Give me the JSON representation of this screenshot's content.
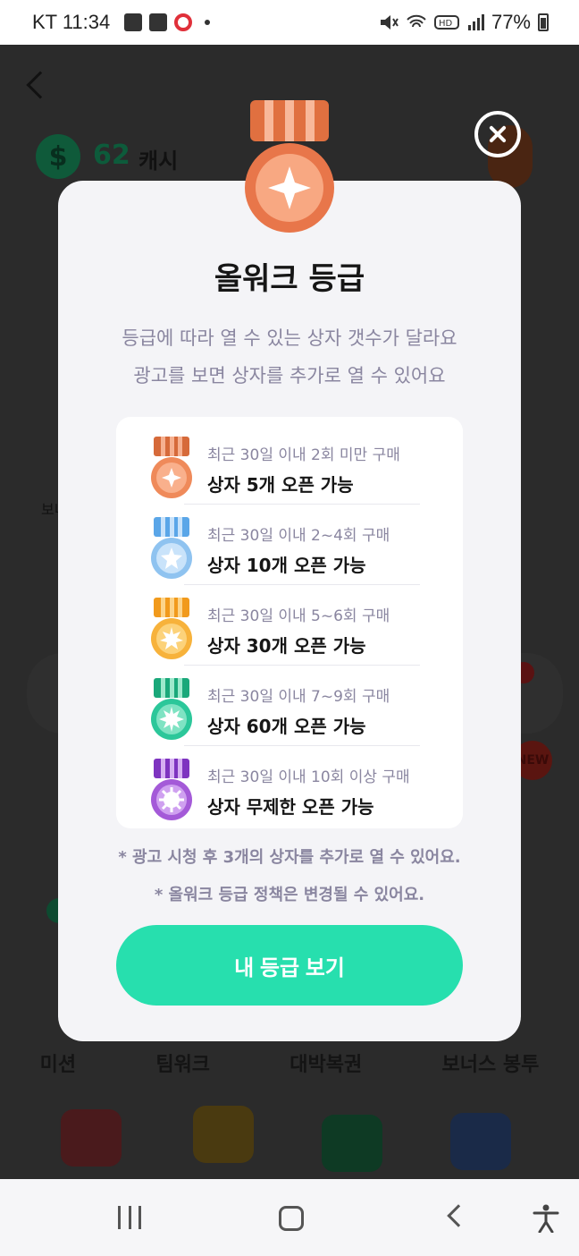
{
  "status_bar": {
    "carrier_time": "KT 11:34",
    "battery": "77%",
    "icons": [
      "gallery-icon",
      "pdf-icon",
      "app-badge-icon",
      "mute-icon",
      "wifi-icon",
      "hd-icon",
      "signal-icon",
      "battery-icon"
    ]
  },
  "background": {
    "cash_amount": "62",
    "cash_unit": "캐시",
    "section_label": "보너",
    "new_badge": "NEW",
    "menu": [
      "미션",
      "팀워크",
      "대박복권",
      "보너스 봉투"
    ]
  },
  "modal": {
    "title": "올워크 등급",
    "subtitle_1": "등급에 따라 열 수 있는 상자 갯수가 달라요",
    "subtitle_2": "광고를 보면 상자를 추가로 열 수 있어요",
    "tiers": [
      {
        "condition": "최근 30일 이내 2회 미만 구매",
        "open": "상자 5개 오픈 가능",
        "color": "#ef8a5a"
      },
      {
        "condition": "최근 30일 이내 2~4회 구매",
        "open": "상자 10개 오픈 가능",
        "color": "#8fc3f0"
      },
      {
        "condition": "최근 30일 이내 5~6회 구매",
        "open": "상자 30개 오픈 가능",
        "color": "#f7b23b"
      },
      {
        "condition": "최근 30일 이내 7~9회 구매",
        "open": "상자 60개 오픈 가능",
        "color": "#2cc79a"
      },
      {
        "condition": "최근 30일 이내 10회 이상 구매",
        "open": "상자 무제한 오픈 가능",
        "color": "#a45ad8"
      }
    ],
    "note_1": "* 광고 시청 후 3개의 상자를 추가로 열 수 있어요.",
    "note_2": "* 올워크 등급 정책은 변경될 수 있어요.",
    "cta_label": "내 등급 보기"
  }
}
